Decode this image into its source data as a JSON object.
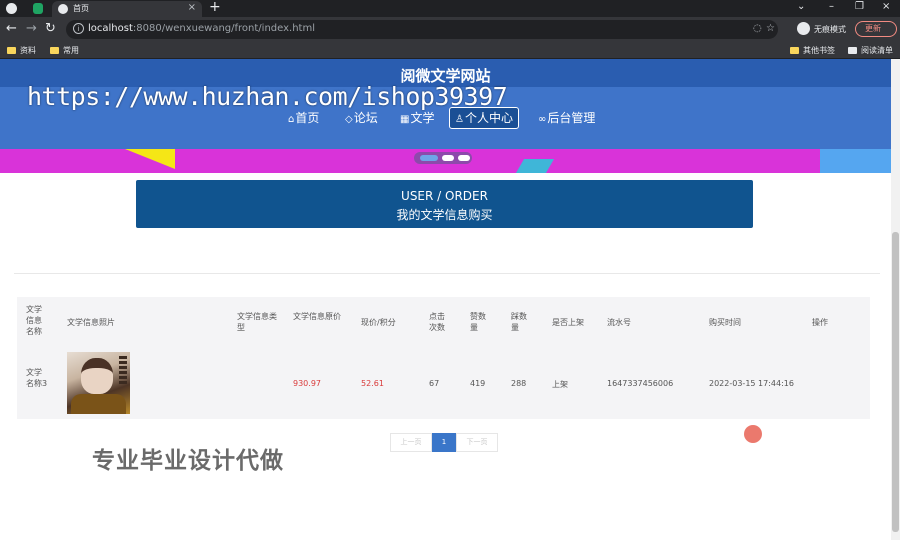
{
  "browser": {
    "tab_title": "首页",
    "url_host": "localhost",
    "url_rest": ":8080/wenxuewang/front/index.html",
    "incognito_label": "无痕模式",
    "update_label": "更新",
    "bookmarks": [
      "资料",
      "常用",
      "其他书签",
      "阅读清单"
    ]
  },
  "site": {
    "title": "阅微文学网站",
    "watermark_url": "https://www.huzhan.com/ishop39397",
    "nav": [
      {
        "label": "首页",
        "icon": "⌂"
      },
      {
        "label": "论坛",
        "icon": "◇"
      },
      {
        "label": "文学",
        "icon": "▦"
      },
      {
        "label": "个人中心",
        "icon": "♙"
      },
      {
        "label": "后台管理",
        "icon": "∞"
      }
    ]
  },
  "banner": {
    "en": "USER / ORDER",
    "cn": "我的文学信息购买"
  },
  "table": {
    "headers": [
      "文学信息名称",
      "文学信息照片",
      "文学信息类型",
      "文学信息原价",
      "现价/积分",
      "点击次数",
      "赞数量",
      "踩数量",
      "是否上架",
      "流水号",
      "购买时间",
      "操作"
    ],
    "rows": [
      {
        "name": "文学名称3",
        "photo_alt": "book-cover",
        "type": "",
        "original_price": "930.97",
        "price_points": "52.61",
        "clicks": "67",
        "likes": "419",
        "dislikes": "288",
        "on_shelf": "上架",
        "serial": "1647337456006",
        "purchase_time": "2022-03-15 17:44:16",
        "action": ""
      }
    ]
  },
  "pager": {
    "prev": "上一页",
    "current": "1",
    "next": "下一页"
  },
  "overlay_text": "专业毕业设计代做",
  "colors": {
    "header_blue": "#2a5db0",
    "banner_blue": "#10548f",
    "price_red": "#d93b3b",
    "pager_active": "#3a76c9"
  }
}
